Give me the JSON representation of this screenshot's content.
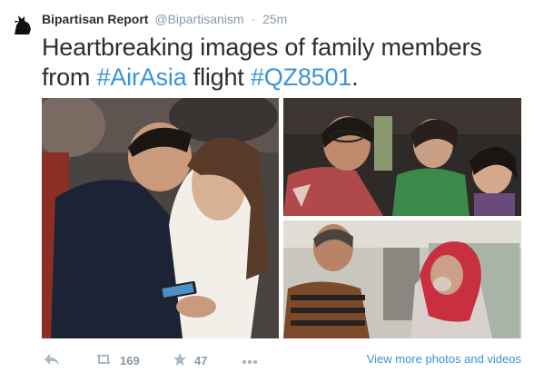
{
  "author": {
    "name": "Bipartisan Report",
    "handle": "@Bipartisanism",
    "separator": "·",
    "time": "25m"
  },
  "tweet": {
    "text_before": "Heartbreaking images of family members from ",
    "hashtag1": "#AirAsia",
    "text_middle": " flight ",
    "hashtag2": "#QZ8501",
    "text_after": "."
  },
  "media": {
    "photos": [
      "couple-consoling-photo",
      "crying-women-photo",
      "grieving-relatives-photo"
    ]
  },
  "actions": {
    "reply_icon": "reply-icon",
    "retweet_icon": "retweet-icon",
    "retweet_count": "169",
    "favorite_icon": "star-icon",
    "favorite_count": "47",
    "more_icon": "more-icon",
    "view_more": "View more photos and videos"
  },
  "colors": {
    "link": "#3b94d9",
    "muted": "#8899a6",
    "text": "#292f33"
  }
}
